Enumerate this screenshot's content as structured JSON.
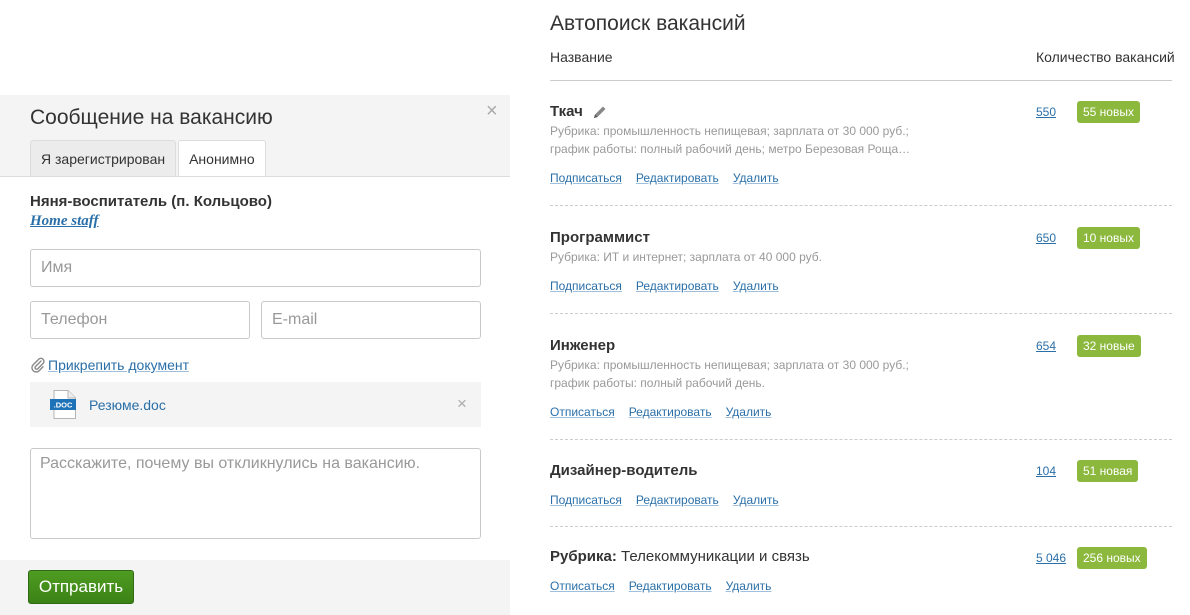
{
  "apply": {
    "title": "Сообщение на вакансию",
    "tabs": [
      "Я зарегистрирован",
      "Анонимно"
    ],
    "active_tab": "Анонимно",
    "vacancy_title": "Няня-воспитатель (п. Кольцово)",
    "company": "Home staff",
    "name_placeholder": "Имя",
    "phone_placeholder": "Телефон",
    "email_placeholder": "E-mail",
    "attach_label": "Прикрепить документ",
    "doc_badge": ".DOC",
    "file_name": "Резюме.doc",
    "message_placeholder": "Расскажите, почему вы откликнулись на вакансию.",
    "submit_label": "Отправить",
    "close_glyph": "×"
  },
  "search": {
    "title": "Автопоиск вакансий",
    "col_name": "Название",
    "col_count": "Количество вакансий",
    "rows": [
      {
        "title": "Ткач",
        "description": "Рубрика: промышленность непищевая; зарплата от 30 000 руб.; график работы: полный рабочий день; метро Березовая Роща…",
        "actions": [
          "Подписаться",
          "Редактировать",
          "Удалить"
        ],
        "count": "550",
        "badge": "55 новых"
      },
      {
        "title": "Программист",
        "description": "Рубрика: ИТ и интернет; зарплата от 40 000 руб.",
        "actions": [
          "Подписаться",
          "Редактировать",
          "Удалить"
        ],
        "count": "650",
        "badge": "10 новых"
      },
      {
        "title": "Инженер",
        "description": "Рубрика: промышленность непищевая; зарплата от 30 000 руб.; график работы: полный рабочий день.",
        "actions": [
          "Отписаться",
          "Редактировать",
          "Удалить"
        ],
        "count": "654",
        "badge": "32 новые"
      },
      {
        "title": "Дизайнер-водитель",
        "description": "",
        "actions": [
          "Подписаться",
          "Редактировать",
          "Удалить"
        ],
        "count": "104",
        "badge": "51 новая"
      },
      {
        "title": "Рубрика:",
        "title_value": "Телекоммуникации и связь",
        "description": "",
        "actions": [
          "Отписаться",
          "Редактировать",
          "Удалить"
        ],
        "count": "5 046",
        "badge": "256 новых"
      }
    ]
  },
  "colors": {
    "link": "#2a6fa8",
    "badge_green": "#8cb83e",
    "submit_green": "#3b8215",
    "panel_gray": "#f4f4f4"
  },
  "icons": [
    "close-icon",
    "pencil-icon",
    "paperclip-icon",
    "doc-file-icon"
  ]
}
